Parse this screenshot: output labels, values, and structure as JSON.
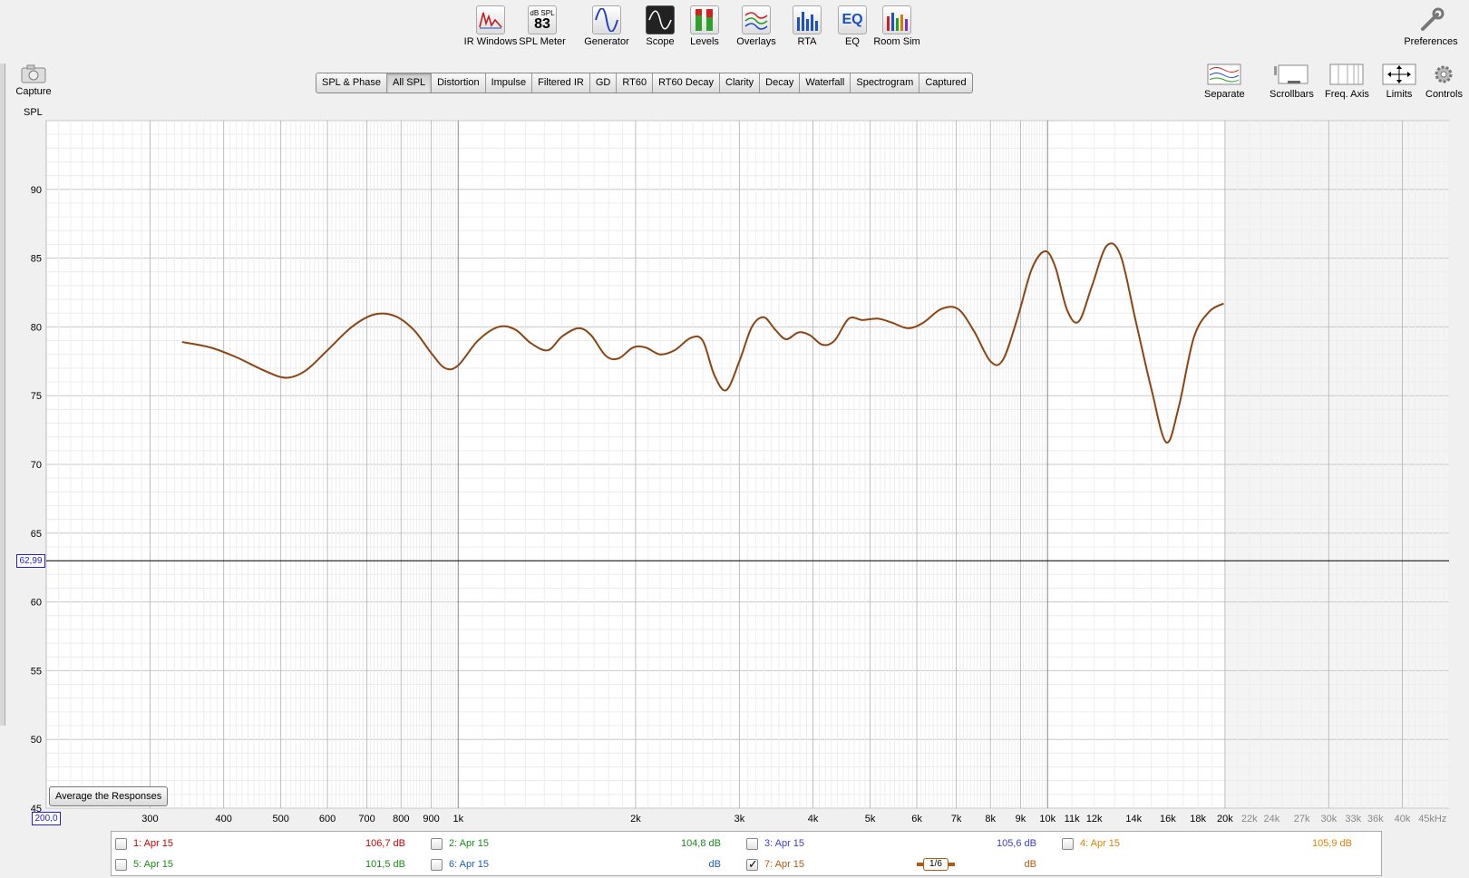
{
  "toolbar": {
    "items": [
      {
        "label": "IR Windows"
      },
      {
        "label": "SPL Meter",
        "top": "dB SPL",
        "value": "83"
      },
      {
        "label": "Generator"
      },
      {
        "label": "Scope"
      },
      {
        "label": "Levels"
      },
      {
        "label": "Overlays"
      },
      {
        "label": "RTA"
      },
      {
        "label": "EQ",
        "text": "EQ"
      },
      {
        "label": "Room Sim"
      }
    ],
    "preferences": "Preferences"
  },
  "tabs": [
    "SPL & Phase",
    "All SPL",
    "Distortion",
    "Impulse",
    "Filtered IR",
    "GD",
    "RT60",
    "RT60 Decay",
    "Clarity",
    "Decay",
    "Waterfall",
    "Spectrogram",
    "Captured"
  ],
  "active_tab": "All SPL",
  "right_tools": [
    "Separate",
    "Scrollbars",
    "Freq. Axis",
    "Limits",
    "Controls"
  ],
  "capture_label": "Capture",
  "y_axis_label": "SPL",
  "avg_button": "Average the Responses",
  "cursor_y": "62,99",
  "cursor_x": "200,0",
  "curve_color": "#8B4513",
  "chart_data": {
    "type": "line",
    "xscale": "log",
    "xlim": [
      200,
      48000
    ],
    "ylim": [
      45,
      95
    ],
    "ylabel": "SPL",
    "yticks": [
      45,
      50,
      55,
      60,
      65,
      70,
      75,
      80,
      85,
      90
    ],
    "xticks": [
      {
        "v": 300,
        "t": "300"
      },
      {
        "v": 400,
        "t": "400"
      },
      {
        "v": 500,
        "t": "500"
      },
      {
        "v": 600,
        "t": "600"
      },
      {
        "v": 700,
        "t": "700"
      },
      {
        "v": 800,
        "t": "800"
      },
      {
        "v": 900,
        "t": "900"
      },
      {
        "v": 1000,
        "t": "1k"
      },
      {
        "v": 2000,
        "t": "2k"
      },
      {
        "v": 3000,
        "t": "3k"
      },
      {
        "v": 4000,
        "t": "4k"
      },
      {
        "v": 5000,
        "t": "5k"
      },
      {
        "v": 6000,
        "t": "6k"
      },
      {
        "v": 7000,
        "t": "7k"
      },
      {
        "v": 8000,
        "t": "8k"
      },
      {
        "v": 9000,
        "t": "9k"
      },
      {
        "v": 10000,
        "t": "10k"
      },
      {
        "v": 11000,
        "t": "11k"
      },
      {
        "v": 12000,
        "t": "12k"
      },
      {
        "v": 14000,
        "t": "14k"
      },
      {
        "v": 16000,
        "t": "16k"
      },
      {
        "v": 18000,
        "t": "18k"
      },
      {
        "v": 20000,
        "t": "20k"
      },
      {
        "v": 22000,
        "t": "22k"
      },
      {
        "v": 24000,
        "t": "24k"
      },
      {
        "v": 27000,
        "t": "27k"
      },
      {
        "v": 30000,
        "t": "30k"
      },
      {
        "v": 33000,
        "t": "33k"
      },
      {
        "v": 36000,
        "t": "36k"
      },
      {
        "v": 40000,
        "t": "40k"
      },
      {
        "v": 45000,
        "t": "45kHz"
      }
    ],
    "grey_freq_from": 20000,
    "hline": 62.99,
    "series": [
      {
        "name": "7: Apr 15",
        "points": [
          [
            340,
            78.9
          ],
          [
            380,
            78.5
          ],
          [
            420,
            77.8
          ],
          [
            470,
            76.8
          ],
          [
            510,
            76.3
          ],
          [
            550,
            76.8
          ],
          [
            600,
            78.3
          ],
          [
            660,
            80.0
          ],
          [
            720,
            80.9
          ],
          [
            780,
            80.8
          ],
          [
            840,
            79.8
          ],
          [
            900,
            78.1
          ],
          [
            950,
            77.0
          ],
          [
            1000,
            77.2
          ],
          [
            1080,
            79.0
          ],
          [
            1170,
            80.0
          ],
          [
            1250,
            79.8
          ],
          [
            1330,
            78.8
          ],
          [
            1420,
            78.3
          ],
          [
            1500,
            79.3
          ],
          [
            1600,
            79.9
          ],
          [
            1680,
            79.4
          ],
          [
            1780,
            77.9
          ],
          [
            1870,
            77.7
          ],
          [
            1980,
            78.5
          ],
          [
            2080,
            78.5
          ],
          [
            2200,
            78.0
          ],
          [
            2330,
            78.3
          ],
          [
            2480,
            79.2
          ],
          [
            2600,
            79.0
          ],
          [
            2720,
            76.5
          ],
          [
            2850,
            75.4
          ],
          [
            3000,
            77.5
          ],
          [
            3150,
            80.0
          ],
          [
            3300,
            80.7
          ],
          [
            3450,
            79.8
          ],
          [
            3600,
            79.1
          ],
          [
            3780,
            79.6
          ],
          [
            3950,
            79.4
          ],
          [
            4150,
            78.7
          ],
          [
            4350,
            79.0
          ],
          [
            4600,
            80.6
          ],
          [
            4850,
            80.5
          ],
          [
            5150,
            80.6
          ],
          [
            5450,
            80.3
          ],
          [
            5800,
            79.9
          ],
          [
            6150,
            80.3
          ],
          [
            6600,
            81.3
          ],
          [
            7050,
            81.3
          ],
          [
            7500,
            79.7
          ],
          [
            8000,
            77.5
          ],
          [
            8400,
            77.6
          ],
          [
            8900,
            80.7
          ],
          [
            9400,
            84.2
          ],
          [
            9900,
            85.5
          ],
          [
            10300,
            84.4
          ],
          [
            10800,
            81.2
          ],
          [
            11300,
            80.4
          ],
          [
            11900,
            83.0
          ],
          [
            12600,
            85.9
          ],
          [
            13300,
            85.2
          ],
          [
            14100,
            80.5
          ],
          [
            15000,
            75.5
          ],
          [
            15900,
            71.6
          ],
          [
            16700,
            74.2
          ],
          [
            17700,
            79.2
          ],
          [
            18800,
            81.1
          ],
          [
            19900,
            81.7
          ]
        ]
      }
    ]
  },
  "legend": [
    {
      "name": "1: Apr 15",
      "value": "106,7 dB",
      "color": "#cc0000",
      "checked": false,
      "col": 0,
      "row": 0
    },
    {
      "name": "2: Apr 15",
      "value": "104,8 dB",
      "color": "#1a8a1a",
      "checked": false,
      "col": 1,
      "row": 0
    },
    {
      "name": "3: Apr 15",
      "value": "105,6 dB",
      "color": "#3c3cd0",
      "checked": false,
      "col": 2,
      "row": 0
    },
    {
      "name": "4: Apr 15",
      "value": "105,9 dB",
      "color": "#e08000",
      "checked": false,
      "col": 3,
      "row": 0
    },
    {
      "name": "5: Apr 15",
      "value": "101,5 dB",
      "color": "#1a8a1a",
      "checked": false,
      "col": 0,
      "row": 1
    },
    {
      "name": "6: Apr 15",
      "value": "dB",
      "color": "#1f5fb0",
      "checked": false,
      "col": 1,
      "row": 1
    },
    {
      "name": "7: Apr 15",
      "value": "dB",
      "color": "#b05a14",
      "checked": true,
      "col": 2,
      "row": 1,
      "smoothing": "1/6"
    }
  ]
}
